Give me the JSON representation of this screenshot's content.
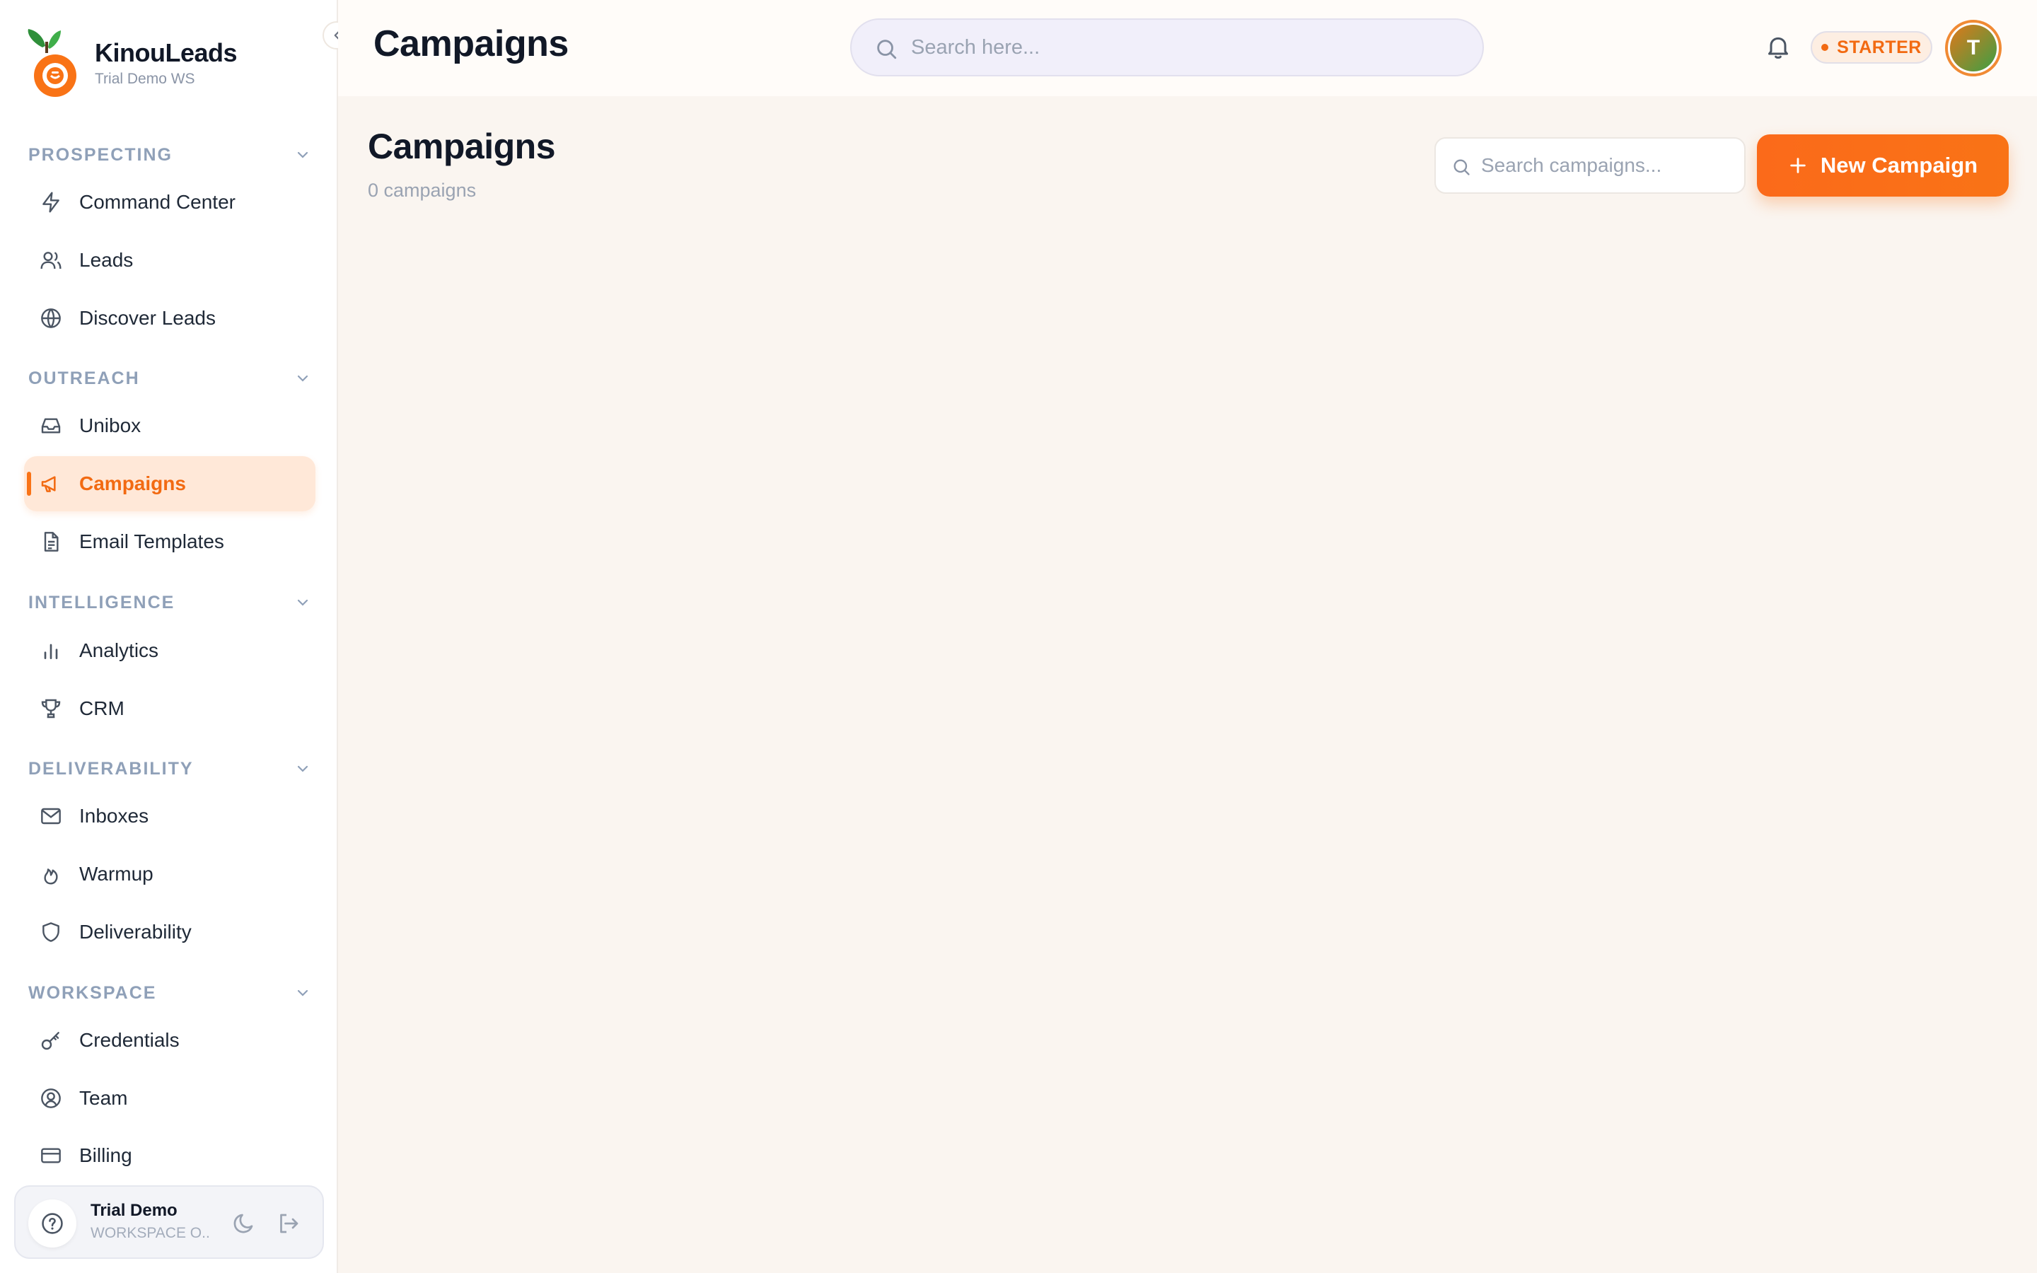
{
  "brand": {
    "name": "KinouLeads",
    "workspace": "Trial Demo WS"
  },
  "sidebar": {
    "sections": [
      {
        "label": "PROSPECTING",
        "items": [
          {
            "label": "Command Center",
            "icon": "lightning-icon"
          },
          {
            "label": "Leads",
            "icon": "users-icon"
          },
          {
            "label": "Discover Leads",
            "icon": "globe-icon"
          }
        ]
      },
      {
        "label": "OUTREACH",
        "items": [
          {
            "label": "Unibox",
            "icon": "inbox-icon"
          },
          {
            "label": "Campaigns",
            "icon": "megaphone-icon",
            "active": true
          },
          {
            "label": "Email Templates",
            "icon": "document-icon"
          }
        ]
      },
      {
        "label": "INTELLIGENCE",
        "items": [
          {
            "label": "Analytics",
            "icon": "bar-chart-icon"
          },
          {
            "label": "CRM",
            "icon": "trophy-icon"
          }
        ]
      },
      {
        "label": "DELIVERABILITY",
        "items": [
          {
            "label": "Inboxes",
            "icon": "mail-icon"
          },
          {
            "label": "Warmup",
            "icon": "flame-icon"
          },
          {
            "label": "Deliverability",
            "icon": "shield-icon"
          }
        ]
      },
      {
        "label": "WORKSPACE",
        "items": [
          {
            "label": "Credentials",
            "icon": "key-icon"
          },
          {
            "label": "Team",
            "icon": "user-circle-icon"
          },
          {
            "label": "Billing",
            "icon": "credit-card-icon"
          }
        ]
      }
    ]
  },
  "user": {
    "name": "Trial Demo",
    "role": "WORKSPACE O..."
  },
  "header": {
    "title": "Campaigns",
    "search_placeholder": "Search here...",
    "plan": "STARTER",
    "avatar_initial": "T"
  },
  "page": {
    "title": "Campaigns",
    "count_text": "0 campaigns",
    "search_placeholder": "Search campaigns...",
    "new_button_label": "New Campaign"
  },
  "colors": {
    "accent": "#f97316",
    "active_bg": "#ffe8d8",
    "page_bg": "#faf5f0",
    "section_label": "#8fa0b8"
  }
}
